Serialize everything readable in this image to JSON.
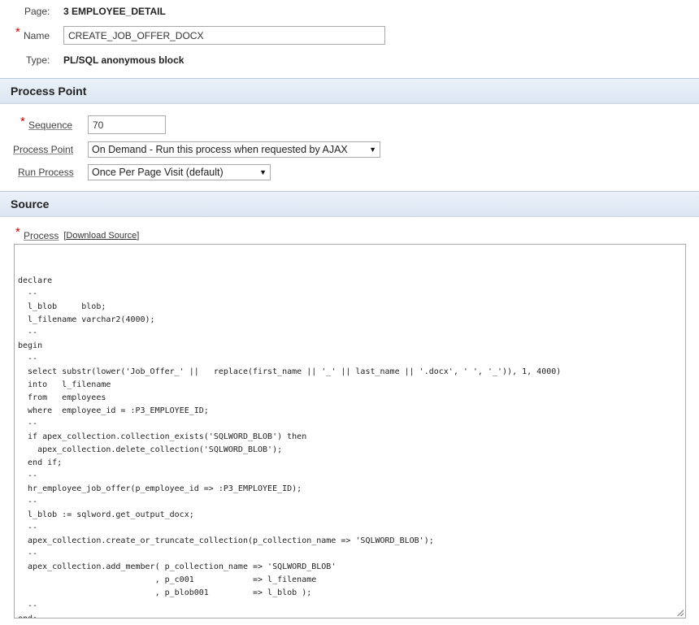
{
  "identification": {
    "page_label": "Page:",
    "page_value": "3 EMPLOYEE_DETAIL",
    "name_label": "Name",
    "name_value": "CREATE_JOB_OFFER_DOCX",
    "type_label": "Type:",
    "type_value": "PL/SQL anonymous block"
  },
  "process_point_section": {
    "title": "Process Point",
    "sequence_label": "Sequence",
    "sequence_value": "70",
    "process_point_label": "Process Point",
    "process_point_value": "On Demand - Run this process when requested by AJAX",
    "run_process_label": "Run Process",
    "run_process_value": "Once Per Page Visit (default)"
  },
  "source_section": {
    "title": "Source",
    "process_label": "Process",
    "download_open": "[",
    "download_link": "Download Source",
    "download_close": "]",
    "code": "declare\n  --\n  l_blob     blob;\n  l_filename varchar2(4000);\n  --\nbegin\n  --\n  select substr(lower('Job_Offer_' ||   replace(first_name || '_' || last_name || '.docx', ' ', '_')), 1, 4000)\n  into   l_filename\n  from   employees\n  where  employee_id = :P3_EMPLOYEE_ID;\n  --\n  if apex_collection.collection_exists('SQLWORD_BLOB') then\n    apex_collection.delete_collection('SQLWORD_BLOB');\n  end if;\n  --\n  hr_employee_job_offer(p_employee_id => :P3_EMPLOYEE_ID);\n  --\n  l_blob := sqlword.get_output_docx;\n  --\n  apex_collection.create_or_truncate_collection(p_collection_name => 'SQLWORD_BLOB');\n  --\n  apex_collection.add_member( p_collection_name => 'SQLWORD_BLOB'\n                            , p_c001            => l_filename\n                            , p_blob001         => l_blob );\n  --\nend;"
  },
  "symbols": {
    "required": "*",
    "dropdown_caret": "▼"
  }
}
